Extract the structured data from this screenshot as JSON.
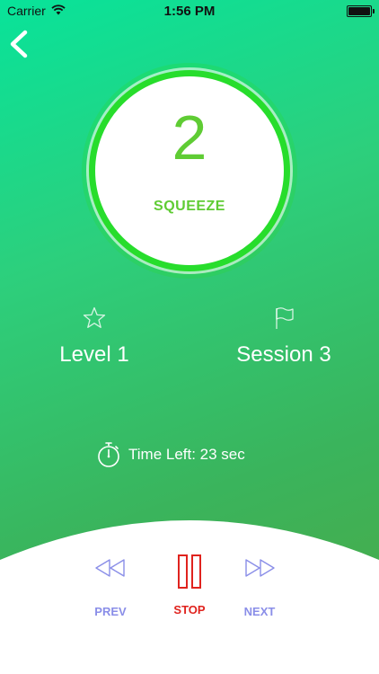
{
  "status_bar": {
    "carrier": "Carrier",
    "time": "1:56 PM"
  },
  "counter": {
    "value": "2",
    "action": "SQUEEZE"
  },
  "stats": {
    "level": {
      "icon": "star-icon",
      "label": "Level 1"
    },
    "session": {
      "icon": "flag-icon",
      "label": "Session 3"
    }
  },
  "timer": {
    "icon": "stopwatch-icon",
    "text": "Time Left: 23 sec"
  },
  "controls": {
    "prev": {
      "label": "PREV",
      "color": "#8a8ee8"
    },
    "stop": {
      "label": "STOP",
      "color": "#e0231e"
    },
    "next": {
      "label": "NEXT",
      "color": "#8a8ee8"
    }
  },
  "colors": {
    "background_top": "#08e39a",
    "background_bottom": "#4ca946",
    "counter_ring": "#27dd2c",
    "counter_text": "#5fcc34"
  }
}
